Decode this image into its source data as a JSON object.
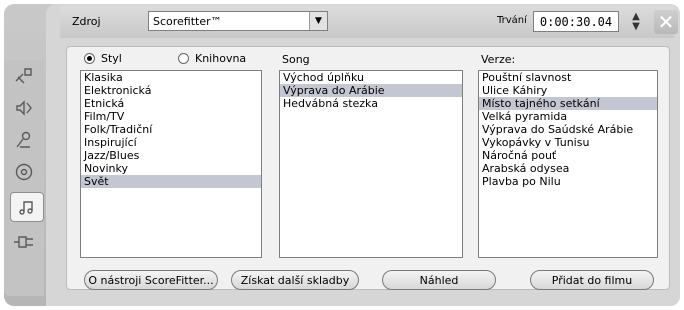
{
  "topbar": {
    "source_label": "Zdroj",
    "source_value": "Scorefitter™",
    "duration_label": "Trvání",
    "duration_value": "0:00:30.04",
    "close_glyph": "✕"
  },
  "rail": {
    "icons": [
      "trim-icon",
      "audio-volume-icon",
      "narration-icon",
      "disc-icon",
      "music-icon",
      "plug-icon"
    ],
    "active_index": 4
  },
  "mode": {
    "style_label": "Styl",
    "library_label": "Knihovna",
    "selected": "Styl"
  },
  "columns": {
    "song_label": "Song",
    "version_label": "Verze:"
  },
  "styles": [
    "Klasika",
    "Elektronická",
    "Etnická",
    "Film/TV",
    "Folk/Tradiční",
    "Inspirující",
    "Jazz/Blues",
    "Novinky",
    "Svět"
  ],
  "styles_selected": "Svět",
  "songs": [
    "Východ úplňku",
    "Výprava do Arábie",
    "Hedvábná stezka"
  ],
  "songs_selected": "Výprava do Arábie",
  "versions": [
    "Pouštní slavnost",
    "Ulice Káhiry",
    "Místo tajného setkání",
    "Velká pyramida",
    "Výprava do Saúdské Arábie",
    "Vykopávky v Tunisu",
    "Náročná pouť",
    "Arabská odysea",
    "Plavba po Nilu"
  ],
  "versions_selected": "Místo tajného setkání",
  "buttons": {
    "about": "O nástroji ScoreFitter...",
    "more_songs": "Získat další skladby",
    "preview": "Náhled",
    "add_to_movie": "Přidat do filmu"
  }
}
